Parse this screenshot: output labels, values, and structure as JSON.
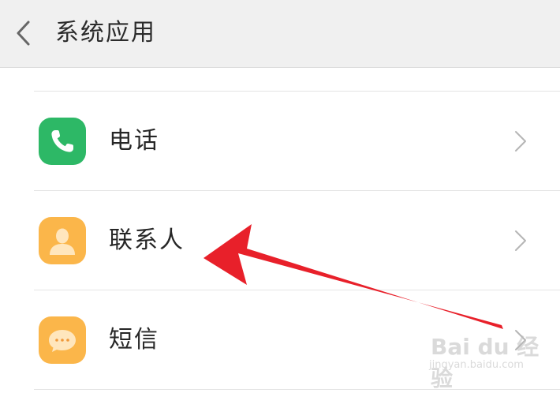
{
  "header": {
    "title": "系统应用",
    "back_icon": "chevron-left-icon"
  },
  "list": {
    "items": [
      {
        "label": "电话",
        "icon": "phone-icon",
        "icon_color": "#2db866"
      },
      {
        "label": "联系人",
        "icon": "contact-person-icon",
        "icon_color": "#fbb64a"
      },
      {
        "label": "短信",
        "icon": "chat-bubble-icon",
        "icon_color": "#fbb64a"
      }
    ],
    "chevron_icon": "chevron-right-icon"
  },
  "annotation": {
    "arrow_color": "#e8202a",
    "arrow_icon": "red-arrow-annotation"
  },
  "watermark": {
    "logo": "Bai du 经验",
    "url": "jingyan.baidu.com"
  }
}
